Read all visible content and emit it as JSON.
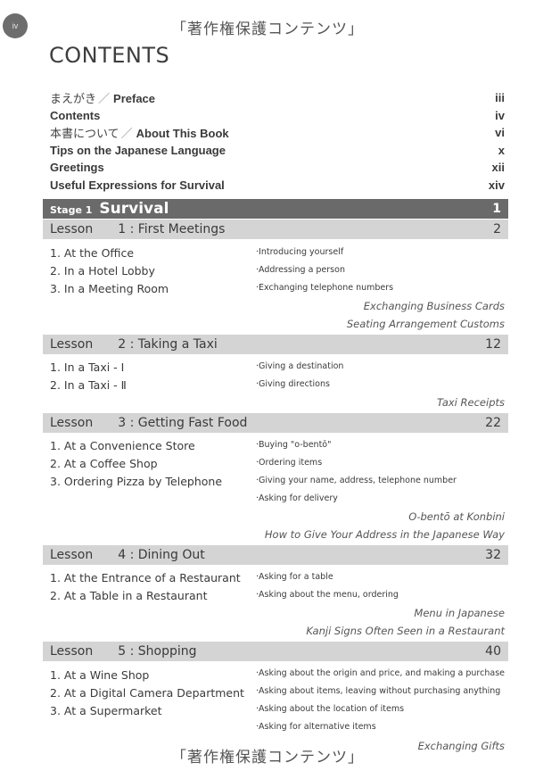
{
  "page_number": "iv",
  "watermark": "「著作権保護コンテンツ」",
  "title": "CONTENTS",
  "front_matter": [
    {
      "jp": "まえがき",
      "en": "Preface",
      "page": "iii"
    },
    {
      "jp": "",
      "en": "Contents",
      "page": "iv"
    },
    {
      "jp": "本書について",
      "en": "About This Book",
      "page": "vi"
    },
    {
      "jp": "",
      "en": "Tips on the Japanese Language",
      "page": "x"
    },
    {
      "jp": "",
      "en": "Greetings",
      "page": "xii"
    },
    {
      "jp": "",
      "en": "Useful Expressions for Survival",
      "page": "xiv"
    }
  ],
  "slash": "／",
  "stage": {
    "label": "Stage 1",
    "name": "Survival",
    "page": "1"
  },
  "lessons": [
    {
      "label": "Lesson",
      "num": "1",
      "title": ": First Meetings",
      "page": "2",
      "items": [
        "1.  At the Office",
        "2.  In a Hotel Lobby",
        "3.  In a Meeting Room"
      ],
      "points": [
        "·Introducing yourself",
        "·Addressing a person",
        "·Exchanging telephone numbers"
      ],
      "columns": [
        "Exchanging Business Cards",
        "Seating Arrangement Customs"
      ]
    },
    {
      "label": "Lesson",
      "num": "2",
      "title": ": Taking a Taxi",
      "page": "12",
      "items": [
        "1.  In a Taxi - I",
        "2.  In a Taxi - Ⅱ"
      ],
      "points": [
        "·Giving a destination",
        "·Giving directions"
      ],
      "columns": [
        "Taxi Receipts"
      ]
    },
    {
      "label": "Lesson",
      "num": "3",
      "title": ": Getting Fast Food",
      "page": "22",
      "items": [
        "1.  At a Convenience Store",
        "2.  At a Coffee Shop",
        "3.  Ordering Pizza by Telephone"
      ],
      "points": [
        "·Buying \"o-bentō\"",
        "·Ordering items",
        "·Giving your name, address, telephone number",
        "·Asking for delivery"
      ],
      "columns": [
        "O-bentō at Konbini",
        "How to Give Your Address in the Japanese Way"
      ]
    },
    {
      "label": "Lesson",
      "num": "4",
      "title": ": Dining Out",
      "page": "32",
      "items": [
        "1.  At the Entrance of a Restaurant",
        "2.  At a Table in a Restaurant"
      ],
      "points": [
        "·Asking for a table",
        "·Asking about the menu, ordering"
      ],
      "columns": [
        "Menu in Japanese",
        "Kanji Signs Often Seen in a Restaurant"
      ]
    },
    {
      "label": "Lesson",
      "num": "5",
      "title": ": Shopping",
      "page": "40",
      "items": [
        "1.  At a Wine Shop",
        "2.  At a Digital Camera Department",
        "3.  At a Supermarket"
      ],
      "points": [
        "·Asking about the origin and price, and making a purchase",
        "·Asking about items, leaving without purchasing anything",
        "·Asking about the location of items",
        "·Asking for alternative items"
      ],
      "columns": [
        "Exchanging Gifts"
      ]
    }
  ]
}
